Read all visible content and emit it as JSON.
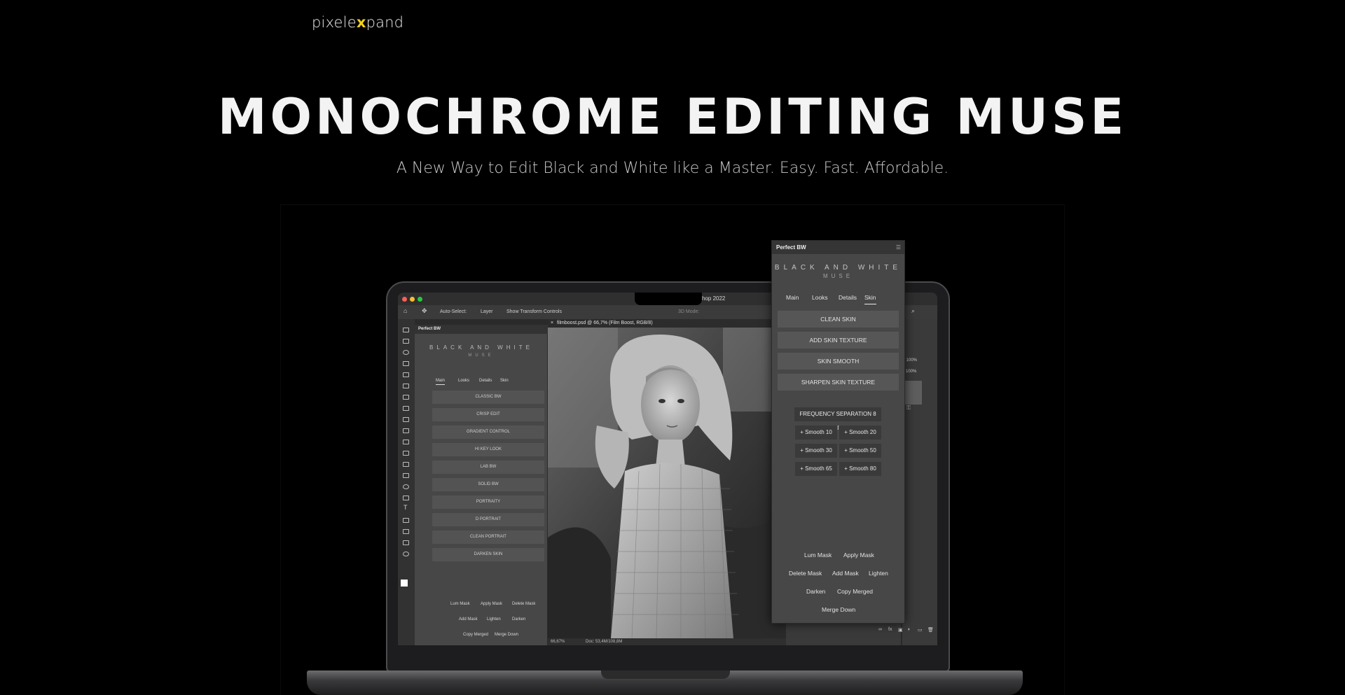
{
  "header": {
    "logo_part1": "pixel",
    "logo_part2": "e",
    "logo_x": "x",
    "logo_part3": "pand",
    "accent_color": "#f2cf1d"
  },
  "hero": {
    "title": "MONOCHROME EDITING MUSE",
    "subtitle": "A New Way to Edit Black and White like a Master. Easy. Fast. Affordable."
  },
  "photoshop": {
    "app_title": "shop 2022",
    "options": {
      "auto_select": "Auto-Select:",
      "layer": "Layer",
      "show_transform": "Show Transform Controls",
      "mode_3d": "3D Mode:"
    },
    "document_tab": "filmboost.psd @ 66,7% (Film Boost, RGB/8)",
    "status_zoom": "66,67%",
    "status_doc": "Doc: 53,4M/108,8M",
    "right_dock": {
      "opacity": "acity: 100%",
      "fill": "Fill: 100%"
    }
  },
  "panel_small": {
    "tab_label": "Perfect BW",
    "brand_line1": "BLACK AND WHITE",
    "brand_line2": "MUSE",
    "tabs": [
      "Main",
      "Looks",
      "Details",
      "Skin"
    ],
    "buttons": [
      "CLASSIC BW",
      "CRISP EDIT",
      "GRADIENT CONTROL",
      "HI KEY LOOK",
      "LAB BW",
      "SOLID BW",
      "PORTRAITY",
      "D PORTRAIT",
      "CLEAN PORTRAIT",
      "DARKEN SKIN"
    ],
    "footer": {
      "lum_mask": "Lum Mask",
      "apply_mask": "Apply Mask",
      "delete_mask": "Delete Mask",
      "add_mask": "Add Mask",
      "lighten": "Lighten",
      "darken": "Darken",
      "copy_merged": "Copy Merged",
      "merge_down": "Merge Down"
    }
  },
  "panel_big": {
    "tab_label": "Perfect BW",
    "menu_icon": "hamburger-icon",
    "brand_line1": "BLACK AND WHITE",
    "brand_line2": "MUSE",
    "tabs": [
      "Main",
      "Looks",
      "Details",
      "Skin"
    ],
    "active_tab": "Skin",
    "skin_buttons": [
      "CLEAN SKIN",
      "ADD SKIN TEXTURE",
      "SKIN SMOOTH",
      "SHARPEN SKIN TEXTURE"
    ],
    "frequency_separation": "FREQUENCY SEPARATION 8 BIT",
    "smooth_buttons": [
      "+ Smooth 10",
      "+ Smooth 20",
      "+ Smooth 30",
      "+ Smooth 50",
      "+ Smooth 65",
      "+ Smooth 80"
    ],
    "footer": {
      "lum_mask": "Lum Mask",
      "apply_mask": "Apply Mask",
      "delete_mask": "Delete Mask",
      "add_mask": "Add Mask",
      "lighten": "Lighten",
      "darken": "Darken",
      "copy_merged": "Copy Merged",
      "merge_down": "Merge Down"
    }
  }
}
